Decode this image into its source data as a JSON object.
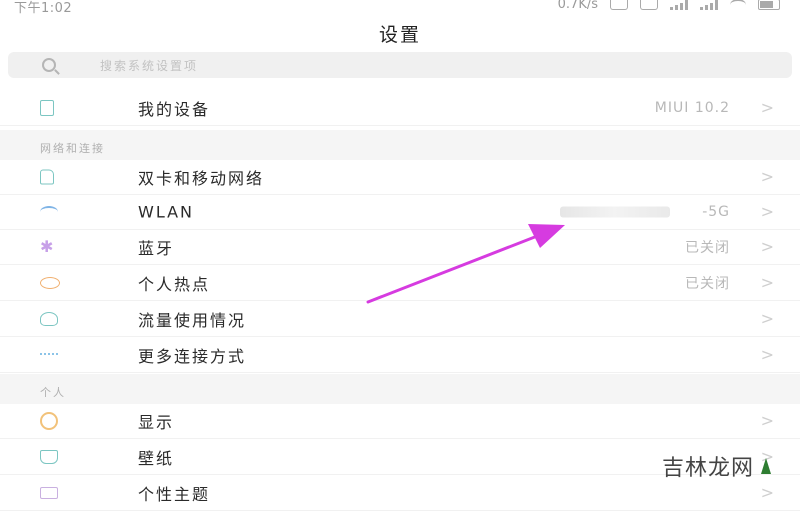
{
  "status_bar": {
    "time": "下午1:02",
    "network_speed": "0.7K/s"
  },
  "header": {
    "title": "设置"
  },
  "search": {
    "placeholder": "搜索系统设置项"
  },
  "top_item": {
    "label": "我的设备",
    "value": "MIUI 10.2",
    "icon": "tablet-icon"
  },
  "sections": [
    {
      "title": "网络和连接",
      "items": [
        {
          "label": "双卡和移动网络",
          "value": "",
          "icon": "sim-card-icon"
        },
        {
          "label": "WLAN",
          "value": "-5G",
          "icon": "wifi-icon"
        },
        {
          "label": "蓝牙",
          "value": "已关闭",
          "icon": "bluetooth-icon"
        },
        {
          "label": "个人热点",
          "value": "已关闭",
          "icon": "hotspot-icon"
        },
        {
          "label": "流量使用情况",
          "value": "",
          "icon": "data-usage-icon"
        },
        {
          "label": "更多连接方式",
          "value": "",
          "icon": "more-connections-icon"
        }
      ]
    },
    {
      "title": "个人",
      "items": [
        {
          "label": "显示",
          "value": "",
          "icon": "display-icon"
        },
        {
          "label": "壁纸",
          "value": "",
          "icon": "wallpaper-icon"
        },
        {
          "label": "个性主题",
          "value": "",
          "icon": "theme-icon"
        }
      ]
    }
  ],
  "chevron": ">",
  "watermark": {
    "text": "吉林龙网"
  },
  "colors": {
    "arrow": "#d63be0",
    "accent_teal": "#7cc6c2",
    "section_bg": "#f5f5f5"
  }
}
